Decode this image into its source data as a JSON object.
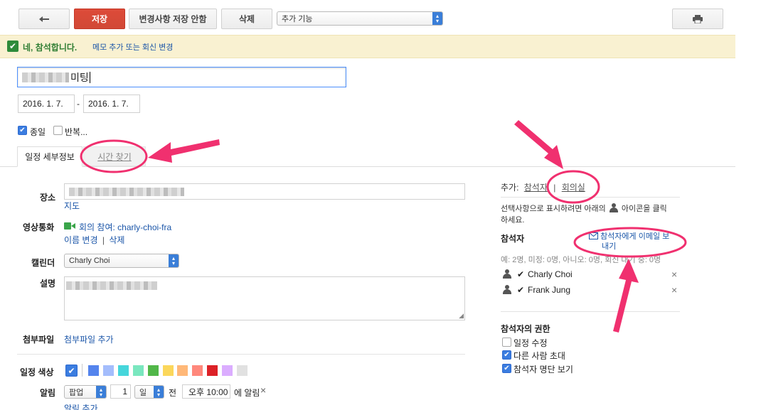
{
  "toolbar": {
    "back_icon": "back-arrow-icon",
    "save_label": "저장",
    "discard_label": "변경사항 저장 안함",
    "delete_label": "삭제",
    "more_actions": "추가 기능",
    "print_icon": "print-icon"
  },
  "rsvp": {
    "text": "네, 참석합니다.",
    "link": "메모 추가 또는 회신 변경"
  },
  "event": {
    "title_suffix": "미팅",
    "start_date": "2016. 1. 7.",
    "date_sep": "-",
    "end_date": "2016. 1. 7.",
    "allday_label": "종일",
    "repeat_label": "반복..."
  },
  "tabs": {
    "details": "일정 세부정보",
    "find_time": "시간 찾기"
  },
  "form": {
    "location_label": "장소",
    "map_link": "지도",
    "video_label": "영상통화",
    "video_join": "회의 참여: charly-choi-fra",
    "video_rename": "이름 변경",
    "video_sep": "|",
    "video_delete": "삭제",
    "calendar_label": "캘린더",
    "calendar_value": "Charly Choi",
    "description_label": "설명",
    "attachment_label": "첨부파일",
    "attachment_add": "첨부파일 추가",
    "color_label": "일정 색상",
    "reminder_label": "알림",
    "reminder_type": "팝업",
    "reminder_amount": "1",
    "reminder_unit": "일",
    "reminder_before": "전",
    "reminder_time": "오후 10:00",
    "reminder_suffix": "에 알림",
    "reminder_remove": "×",
    "reminder_add": "알림 추가",
    "colors": [
      "#5484ed",
      "#a4bdfc",
      "#46d6db",
      "#7ae7bf",
      "#51b749",
      "#fbd75b",
      "#ffb878",
      "#ff887c",
      "#dc2127",
      "#dbadff",
      "#e1e1e1"
    ]
  },
  "guests": {
    "add_label": "추가:",
    "add_guests": "참석자",
    "sep": "|",
    "add_rooms": "회의실",
    "hint": "선택사항으로 표시하려면 아래의 아이콘을 클릭하세요.",
    "hint_before": "선택사항으로 표시하려면 아래의",
    "hint_after": "아이콘을 클릭",
    "hint_line2": "하세요.",
    "title": "참석자",
    "email_link_1": "참석자에게 이메일 보",
    "email_link_2": "내기",
    "summary": "예: 2명, 미정: 0명, 아니오: 0명, 회신 대기 중: 0명",
    "list": [
      {
        "name": "Charly Choi",
        "status": "✔",
        "remove": "×"
      },
      {
        "name": "Frank Jung",
        "status": "✔",
        "remove": "×"
      }
    ],
    "perm_title": "참석자의 권한",
    "perms": [
      {
        "label": "일정 수정",
        "checked": false
      },
      {
        "label": "다른 사람 초대",
        "checked": true
      },
      {
        "label": "참석자 명단 보기",
        "checked": true
      }
    ]
  },
  "annotations": {
    "color": "#f0306f"
  }
}
